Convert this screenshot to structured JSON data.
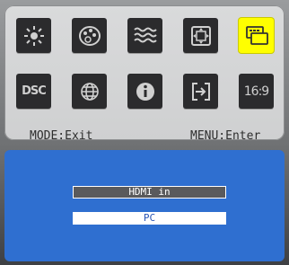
{
  "osd": {
    "icons": [
      {
        "name": "brightness-icon"
      },
      {
        "name": "color-icon"
      },
      {
        "name": "picture-icon"
      },
      {
        "name": "image-position-icon"
      },
      {
        "name": "input-source-icon",
        "selected": true
      },
      {
        "name": "dsc-icon",
        "label": "DSC"
      },
      {
        "name": "language-icon"
      },
      {
        "name": "information-icon"
      },
      {
        "name": "reset-icon"
      },
      {
        "name": "aspect-ratio-icon",
        "label": "16:9"
      }
    ],
    "mode_hint": "MODE:Exit",
    "menu_hint": "MENU:Enter"
  },
  "source_menu": {
    "options": [
      {
        "label": "HDMI in",
        "selected": false
      },
      {
        "label": "PC",
        "selected": true
      }
    ]
  },
  "colors": {
    "selected_tile": "#ffff00",
    "tile": "#2b2b2d",
    "screen": "#2f6fd0"
  }
}
